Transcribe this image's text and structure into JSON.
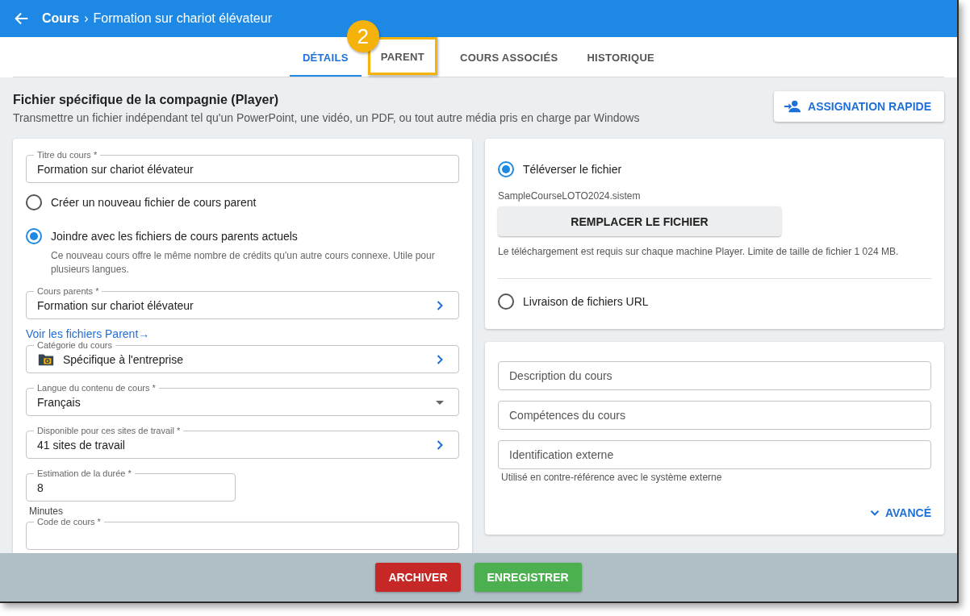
{
  "header": {
    "breadcrumb": "Cours",
    "separator": "›",
    "title": "Formation sur chariot élévateur"
  },
  "tabs": [
    {
      "label": "DÉTAILS",
      "selected": true,
      "highlighted": false
    },
    {
      "label": "PARENT",
      "selected": false,
      "highlighted": true
    },
    {
      "label": "COURS ASSOCIÉS",
      "selected": false,
      "highlighted": false
    },
    {
      "label": "HISTORIQUE",
      "selected": false,
      "highlighted": false
    }
  ],
  "callout": {
    "label": "2"
  },
  "section": {
    "title": "Fichier spécifique de la compagnie (Player)",
    "subtitle": "Transmettre un fichier indépendant tel qu'un PowerPoint, une vidéo, un PDF, ou tout autre média pris en charge par Windows",
    "quick_assign": "ASSIGNATION RAPIDE"
  },
  "left_card": [
    {
      "kind": "text",
      "label": "Titre du cours *",
      "value": "Formation sur chariot élévateur"
    },
    {
      "kind": "radio",
      "label": "Créer un nouveau fichier de cours parent",
      "selected": false
    },
    {
      "kind": "radio",
      "label": "Joindre avec les fichiers de cours parents actuels",
      "selected": true,
      "help": "Ce nouveau cours offre le même nombre de crédits qu'un autre cours connexe. Utile pour plusieurs langues."
    },
    {
      "kind": "picker",
      "label": "Cours parents *",
      "value": "Formation sur chariot élévateur"
    },
    {
      "kind": "link",
      "label": "Voir les fichiers Parent→"
    },
    {
      "kind": "category",
      "label": "Catégorie du cours",
      "value": "Spécifique à l'entreprise"
    },
    {
      "kind": "select",
      "label": "Langue du contenu de cours *",
      "value": "Français"
    },
    {
      "kind": "picker",
      "label": "Disponible pour ces sites de travail *",
      "value": "41 sites de travail"
    },
    {
      "kind": "short",
      "label": "Estimation de la durée *",
      "value": "8",
      "unit": "Minutes"
    },
    {
      "kind": "text",
      "label": "Code de cours *"
    }
  ],
  "upload_card": {
    "options": [
      {
        "label": "Téléverser le fichier",
        "selected": true,
        "file": "SampleCourseLOTO2024.sistem",
        "button": "REMPLACER LE FICHIER",
        "note": "Le téléchargement est requis sur chaque machine Player. Limite de taille de fichier 1 024 MB."
      },
      {
        "label": "Livraison de fichiers URL",
        "selected": false
      }
    ]
  },
  "details_card": {
    "fields": [
      {
        "placeholder": "Description du cours"
      },
      {
        "placeholder": "Compétences du cours"
      },
      {
        "placeholder": "Identification externe",
        "hint": "Utilisé en contre-référence avec le système externe"
      }
    ],
    "advanced": "AVANCÉ"
  },
  "footer": {
    "buttons": [
      {
        "label": "ARCHIVER",
        "kind": "danger"
      },
      {
        "label": "ENREGISTRER",
        "kind": "primary"
      }
    ]
  }
}
